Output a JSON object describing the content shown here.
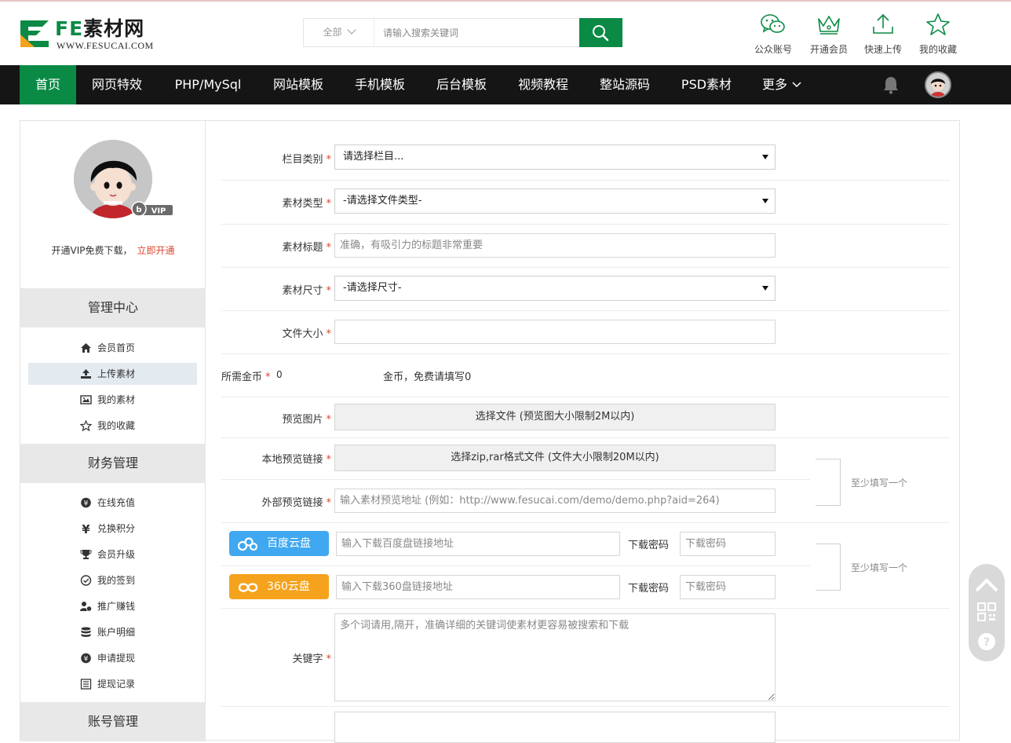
{
  "header": {
    "logo_fe": "FE",
    "logo_cn": "素材网",
    "logo_url": "WWW.FESUCAI.COM",
    "search": {
      "category": "全部",
      "placeholder": "请输入搜索关键词"
    },
    "quick_links": [
      {
        "label": "公众账号",
        "icon": "wechat-icon"
      },
      {
        "label": "开通会员",
        "icon": "crown-icon"
      },
      {
        "label": "快速上传",
        "icon": "upload-icon"
      },
      {
        "label": "我的收藏",
        "icon": "star-icon"
      }
    ]
  },
  "nav": {
    "items": [
      "首页",
      "网页特效",
      "PHP/MySql",
      "网站模板",
      "手机模板",
      "后台模板",
      "视频教程",
      "整站源码",
      "PSD素材",
      "更多"
    ],
    "active_index": 0
  },
  "sidebar": {
    "vip_badge": "VIP",
    "vip_text": "开通VIP免费下载，",
    "vip_link": "立即开通",
    "sections": [
      {
        "title": "管理中心",
        "items": [
          {
            "label": "会员首页",
            "icon": "home-icon"
          },
          {
            "label": "上传素材",
            "icon": "upload-icon",
            "active": true
          },
          {
            "label": "我的素材",
            "icon": "image-icon"
          },
          {
            "label": "我的收藏",
            "icon": "star-icon"
          }
        ]
      },
      {
        "title": "财务管理",
        "items": [
          {
            "label": "在线充值",
            "icon": "yen-circle-icon"
          },
          {
            "label": "兑换积分",
            "icon": "yen-icon"
          },
          {
            "label": "会员升级",
            "icon": "trophy-icon"
          },
          {
            "label": "我的签到",
            "icon": "check-circle-icon"
          },
          {
            "label": "推广赚钱",
            "icon": "user-money-icon"
          },
          {
            "label": "账户明细",
            "icon": "database-icon"
          },
          {
            "label": "申请提现",
            "icon": "yen-circle-icon"
          },
          {
            "label": "提现记录",
            "icon": "list-icon"
          }
        ]
      },
      {
        "title": "账号管理",
        "items": []
      }
    ]
  },
  "form": {
    "category": {
      "label": "栏目类别",
      "value": "请选择栏目..."
    },
    "file_type": {
      "label": "素材类型",
      "value": "-请选择文件类型-"
    },
    "title": {
      "label": "素材标题",
      "placeholder": "准确，有吸引力的标题非常重要"
    },
    "size": {
      "label": "素材尺寸",
      "value": "-请选择尺寸-"
    },
    "file_size": {
      "label": "文件大小",
      "value": ""
    },
    "coins": {
      "label": "所需金币",
      "value": "0",
      "note": "金币，免费请填写0"
    },
    "preview_image": {
      "label": "预览图片",
      "button": "选择文件 (预览图大小限制2M以内)"
    },
    "local_preview": {
      "label": "本地预览链接",
      "button": "选择zip,rar格式文件 (文件大小限制20M以内)"
    },
    "external_preview": {
      "label": "外部预览链接",
      "placeholder": "输入素材预览地址 (例如：http://www.fesucai.com/demo/demo.php?aid=264)"
    },
    "preview_hint": "至少填写一个",
    "baidu": {
      "button": "百度云盘",
      "placeholder": "输入下载百度盘链接地址",
      "pwd_label": "下载密码",
      "pwd_placeholder": "下载密码"
    },
    "pan360": {
      "button": "360云盘",
      "placeholder": "输入下载360盘链接地址",
      "pwd_label": "下载密码",
      "pwd_placeholder": "下载密码"
    },
    "download_hint": "至少填写一个",
    "keywords": {
      "label": "关键字",
      "placeholder": "多个词请用,隔开，准确详细的关键词使素材更容易被搜索和下载"
    },
    "required_mark": "*"
  },
  "colors": {
    "brand_green": "#0b8a45",
    "nav_bg": "#151515",
    "required_red": "#d9462f",
    "baidu_blue": "#3fa8f0",
    "pan360_orange": "#f5a21d"
  }
}
